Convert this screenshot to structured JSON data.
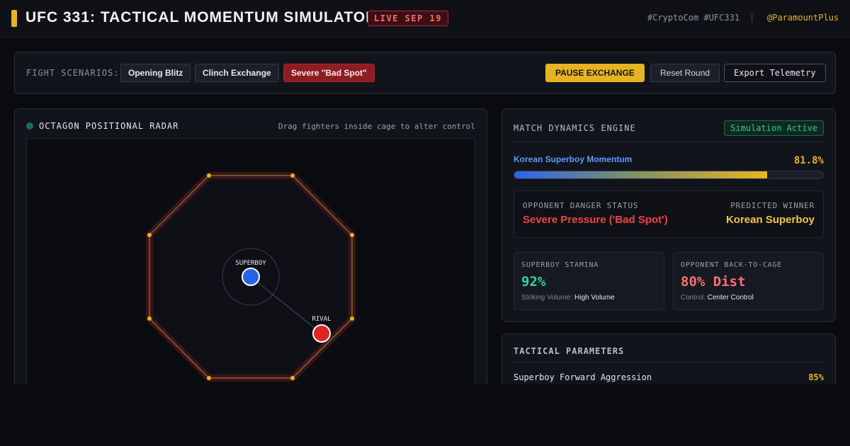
{
  "header": {
    "title": "UFC 331: TACTICAL MOMENTUM SIMULATOR",
    "live_badge": "LIVE SEP 19",
    "hashtags": "#CryptoCom #UFC331",
    "separator": "|",
    "handle": "@ParamountPlus",
    "accent_color": "#e6b422"
  },
  "scenarios": {
    "label": "FIGHT SCENARIOS:",
    "items": [
      {
        "label": "Opening Blitz",
        "active": false
      },
      {
        "label": "Clinch Exchange",
        "active": false
      },
      {
        "label": "Severe \"Bad Spot\"",
        "active": true
      }
    ],
    "actions": {
      "pause": "PAUSE EXCHANGE",
      "reset": "Reset Round",
      "export": "Export Telemetry"
    }
  },
  "radar": {
    "title": "OCTAGON POSITIONAL RADAR",
    "hint": "Drag fighters inside cage to alter control",
    "fighters": [
      {
        "label": "SUPERBOY",
        "color": "#2563eb",
        "icon": "fighter-marker"
      },
      {
        "label": "RIVAL",
        "color": "#dc2626",
        "icon": "fighter-marker"
      }
    ]
  },
  "dynamics": {
    "title": "MATCH DYNAMICS ENGINE",
    "status": "Simulation Active",
    "momentum_label": "Korean Superboy Momentum",
    "momentum_value": "81.8%",
    "momentum_fraction": 0.818,
    "danger_label": "OPPONENT DANGER STATUS",
    "danger_value": "Severe Pressure ('Bad Spot')",
    "winner_label": "PREDICTED WINNER",
    "winner_value": "Korean Superboy",
    "stats": [
      {
        "title": "SUPERBOY STAMINA",
        "value": "92%",
        "value_color": "#34d399",
        "sub_label": "Striking Volume:",
        "sub_value": "High Volume"
      },
      {
        "title": "OPPONENT BACK-TO-CAGE",
        "value": "80% Dist",
        "value_color": "#f87171",
        "sub_label": "Control:",
        "sub_value": "Center Control"
      }
    ]
  },
  "tactical": {
    "title": "TACTICAL PARAMETERS",
    "params": [
      {
        "label": "Superboy Forward Aggression",
        "value": "85%"
      }
    ]
  }
}
